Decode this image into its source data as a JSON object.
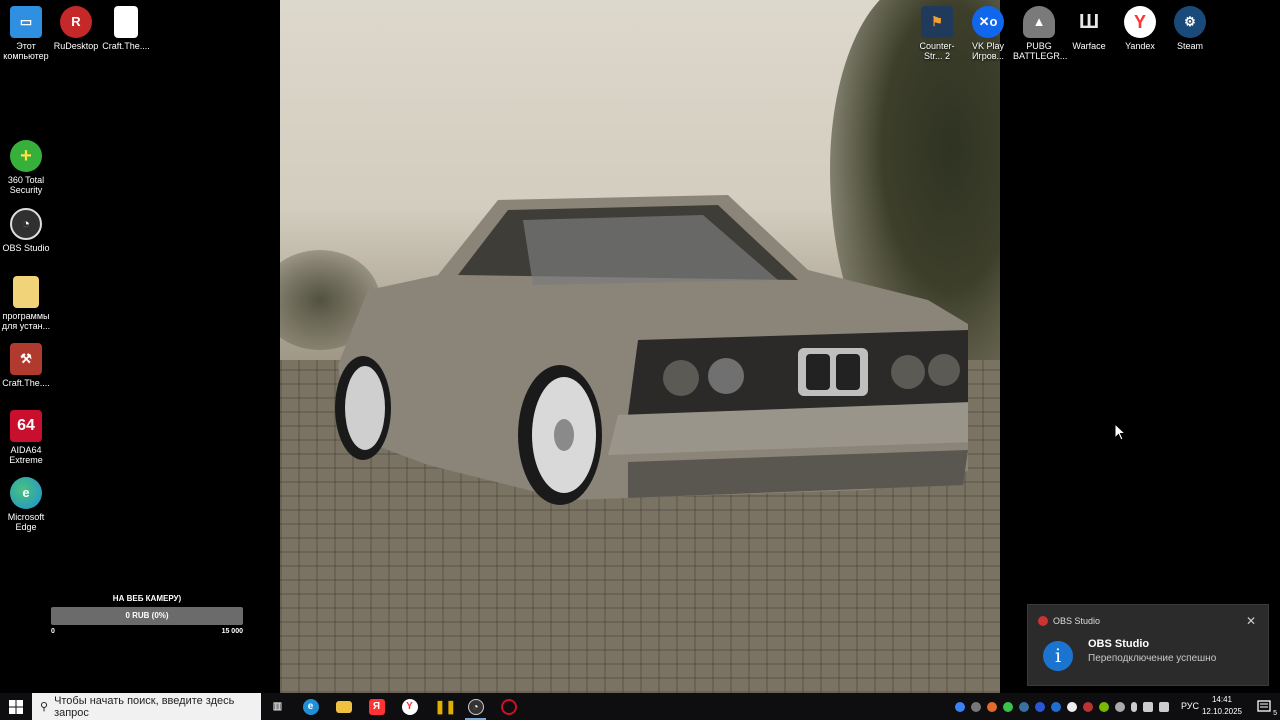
{
  "desktop_icons_left": [
    {
      "label": "Этот компьютер",
      "icon": "this-pc-icon",
      "color": "#2f8fe0"
    },
    {
      "label": "RuDesktop",
      "icon": "rudesktop-icon",
      "color": "#c52828"
    },
    {
      "label": "Craft.The....",
      "icon": "file-shortcut-icon",
      "color": "#ffffff"
    },
    {
      "label": "360 Total Security",
      "icon": "360-security-icon",
      "color": "#36b03a"
    },
    {
      "label": "OBS Studio",
      "icon": "obs-icon",
      "color": "#303030"
    },
    {
      "label": "программы для устан...",
      "icon": "folder-icon",
      "color": "#f1d37a"
    },
    {
      "label": "Craft.The....",
      "icon": "craft-game-icon",
      "color": "#b03a2e"
    },
    {
      "label": "AIDA64 Extreme",
      "icon": "aida64-icon",
      "color": "#c8102e"
    },
    {
      "label": "Microsoft Edge",
      "icon": "edge-icon",
      "color": "#1f8fd8"
    }
  ],
  "desktop_icons_right": [
    {
      "label": "Counter-Str... 2",
      "icon": "cs2-icon",
      "color": "#f0a030"
    },
    {
      "label": "VK Play Игров...",
      "icon": "vkplay-icon",
      "color": "#1166ee"
    },
    {
      "label": "PUBG BATTLEGR...",
      "icon": "pubg-icon",
      "color": "#7a7a7a"
    },
    {
      "label": "Warface",
      "icon": "warface-icon",
      "color": "#e8e8e8"
    },
    {
      "label": "Yandex",
      "icon": "yandex-browser-icon",
      "color": "#ff3333"
    },
    {
      "label": "Steam",
      "icon": "steam-icon",
      "color": "#1a4a7a"
    }
  ],
  "donation_widget": {
    "title": "НА ВЕБ КАМЕРУ)",
    "progress_text": "0 RUB (0%)",
    "progress_fraction": 0,
    "scale_min": "0",
    "scale_max": "15 000"
  },
  "notification": {
    "app_name": "OBS Studio",
    "title": "OBS Studio",
    "message": "Переподключение успешно"
  },
  "taskbar": {
    "search_placeholder": "Чтобы начать поиск, введите здесь запрос",
    "apps": [
      {
        "name": "task-view",
        "glyph": "▥",
        "color": "#0e0e10",
        "active": false
      },
      {
        "name": "edge",
        "glyph": "e",
        "color": "#1f8fd8",
        "active": false
      },
      {
        "name": "file-explorer",
        "glyph": "▬",
        "color": "#f0c040",
        "active": false
      },
      {
        "name": "yandex",
        "glyph": "Я",
        "color": "#ff3333",
        "active": false
      },
      {
        "name": "yandex-browser",
        "glyph": "Y",
        "color": "#ff3333",
        "active": false
      },
      {
        "name": "app-yellow",
        "glyph": "⏸",
        "color": "#e0b000",
        "active": false
      },
      {
        "name": "obs",
        "glyph": "●",
        "color": "#333333",
        "active": true
      },
      {
        "name": "opera",
        "glyph": "O",
        "color": "#cc1122",
        "active": false
      }
    ],
    "language": "РУС",
    "time": "14:41",
    "date": "12.10.2025",
    "notification_count": "5"
  }
}
